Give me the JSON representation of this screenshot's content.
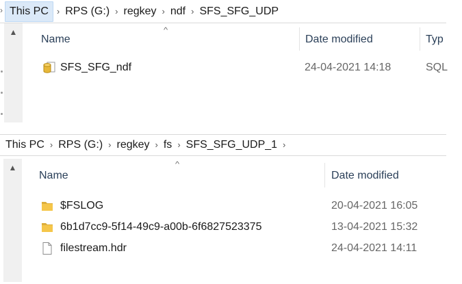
{
  "colors": {
    "breadcrumb_highlight": "#dbe9f8",
    "folder": "#f5c64a",
    "db": "#e7b83a",
    "header_text": "#2a3f58",
    "date_text": "#666666"
  },
  "top_pane": {
    "left_chevron": "›",
    "breadcrumb": [
      "This PC",
      "RPS (G:)",
      "regkey",
      "ndf",
      "SFS_SFG_UDP"
    ],
    "columns": {
      "name": "Name",
      "date": "Date modified",
      "type": "Typ"
    },
    "files": [
      {
        "name": "SFS_SFG_ndf",
        "date": "24-04-2021 14:18",
        "type": "SQL",
        "icon": "database-file-icon"
      }
    ]
  },
  "bottom_pane": {
    "breadcrumb": [
      "This PC",
      "RPS (G:)",
      "regkey",
      "fs",
      "SFS_SFG_UDP_1"
    ],
    "columns": {
      "name": "Name",
      "date": "Date modified"
    },
    "files": [
      {
        "name": "$FSLOG",
        "date": "20-04-2021 16:05",
        "icon": "folder-icon"
      },
      {
        "name": "6b1d7cc9-5f14-49c9-a00b-6f6827523375",
        "date": "13-04-2021 15:32",
        "icon": "folder-icon"
      },
      {
        "name": "filestream.hdr",
        "date": "24-04-2021 14:11",
        "icon": "file-icon"
      }
    ]
  },
  "icons": {
    "separator": "›",
    "scroll_up": "▲",
    "sort": "^"
  }
}
